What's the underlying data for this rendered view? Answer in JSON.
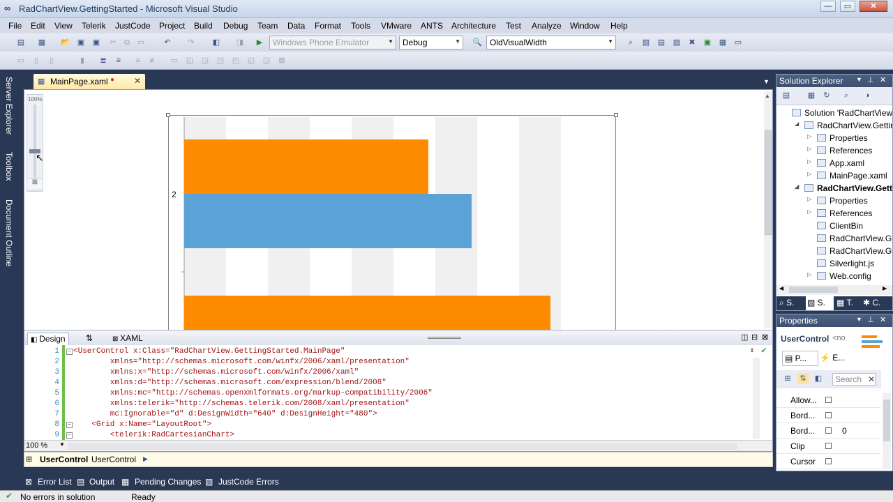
{
  "window": {
    "title": "RadChartView.GettingStarted - Microsoft Visual Studio",
    "minimize_glyph": "—",
    "maximize_glyph": "▭",
    "close_glyph": "✕"
  },
  "menu": [
    "File",
    "Edit",
    "View",
    "Telerik",
    "JustCode",
    "Project",
    "Build",
    "Debug",
    "Team",
    "Data",
    "Format",
    "Tools",
    "VMware",
    "ANTS",
    "Architecture",
    "Test",
    "Analyze",
    "Window",
    "Help"
  ],
  "toolbar": {
    "emulator": "Windows Phone Emulator",
    "config": "Debug",
    "find": "OldVisualWidth"
  },
  "left_tabs": [
    "Server Explorer",
    "Toolbox",
    "Document Outline"
  ],
  "document_tab": {
    "label": "MainPage.xaml",
    "close": "✕"
  },
  "designer": {
    "zoom_indicator": "100%",
    "axis_label": "2",
    "bar_color_orange": "#ff8c00",
    "bar_color_blue": "#5ba3d6"
  },
  "chart_data": {
    "type": "bar",
    "orientation": "horizontal",
    "categories": [
      "",
      "2",
      ""
    ],
    "series": [
      {
        "values": [
          350,
          null,
          525
        ],
        "color": "#ff8c00"
      },
      {
        "values": [
          null,
          412,
          null
        ],
        "color": "#5ba3d6"
      }
    ],
    "xlim": [
      0,
      600
    ],
    "grid": true
  },
  "pane_tabs": {
    "design": "Design",
    "swap": "⇅",
    "xaml": "XAML"
  },
  "xaml": {
    "lines": [
      {
        "num": "1",
        "text": "<UserControl x:Class=\"RadChartView.GettingStarted.MainPage\"",
        "fold": "−"
      },
      {
        "num": "2",
        "text": "        xmlns=\"http://schemas.microsoft.com/winfx/2006/xaml/presentation\""
      },
      {
        "num": "3",
        "text": "        xmlns:x=\"http://schemas.microsoft.com/winfx/2006/xaml\""
      },
      {
        "num": "4",
        "text": "        xmlns:d=\"http://schemas.microsoft.com/expression/blend/2008\""
      },
      {
        "num": "5",
        "text": "        xmlns:mc=\"http://schemas.openxmlformats.org/markup-compatibility/2006\""
      },
      {
        "num": "6",
        "text": "        xmlns:telerik=\"http://schemas.telerik.com/2008/xaml/presentation\""
      },
      {
        "num": "7",
        "text": "        mc:Ignorable=\"d\" d:DesignWidth=\"640\" d:DesignHeight=\"480\">"
      },
      {
        "num": "8",
        "text": "    <Grid x:Name=\"LayoutRoot\">",
        "fold": "−"
      },
      {
        "num": "9",
        "text": "        <telerik:RadCartesianChart>",
        "fold": "−"
      }
    ],
    "zoom": "100 %"
  },
  "breadcrumb": {
    "bold": "UserControl",
    "normal": "UserControl",
    "arrow": "▶"
  },
  "bottom_tabs": [
    "Error List",
    "Output",
    "Pending Changes",
    "JustCode Errors"
  ],
  "status": {
    "left": "No errors in solution",
    "right": "Ready"
  },
  "solution_explorer": {
    "title": "Solution Explorer",
    "items": [
      {
        "label": "Solution 'RadChartView",
        "indent": 0,
        "bold": false
      },
      {
        "label": "RadChartView.Gettin",
        "indent": 1,
        "bold": false,
        "expander": "◢"
      },
      {
        "label": "Properties",
        "indent": 2,
        "expander": "▷"
      },
      {
        "label": "References",
        "indent": 2,
        "expander": "▷"
      },
      {
        "label": "App.xaml",
        "indent": 2,
        "expander": "▷"
      },
      {
        "label": "MainPage.xaml",
        "indent": 2,
        "expander": "▷"
      },
      {
        "label": "RadChartView.Gett",
        "indent": 1,
        "bold": true,
        "expander": "◢"
      },
      {
        "label": "Properties",
        "indent": 2,
        "expander": "▷"
      },
      {
        "label": "References",
        "indent": 2,
        "expander": "▷"
      },
      {
        "label": "ClientBin",
        "indent": 2
      },
      {
        "label": "RadChartView.Gt",
        "indent": 2
      },
      {
        "label": "RadChartView.Gt",
        "indent": 2
      },
      {
        "label": "Silverlight.js",
        "indent": 2
      },
      {
        "label": "Web.config",
        "indent": 2,
        "expander": "▷"
      }
    ],
    "tabs": [
      "S.",
      "S.",
      "T.",
      "C."
    ]
  },
  "properties": {
    "title": "Properties",
    "object": "UserControl",
    "object_type": "<no",
    "tab_props": "P...",
    "tab_events": "E...",
    "search_placeholder": "Search",
    "rows": [
      {
        "name": "Allow...",
        "value": ""
      },
      {
        "name": "Bord...",
        "value": ""
      },
      {
        "name": "Bord...",
        "value": "0"
      },
      {
        "name": "Clip",
        "value": ""
      },
      {
        "name": "Cursor",
        "value": ""
      }
    ]
  }
}
